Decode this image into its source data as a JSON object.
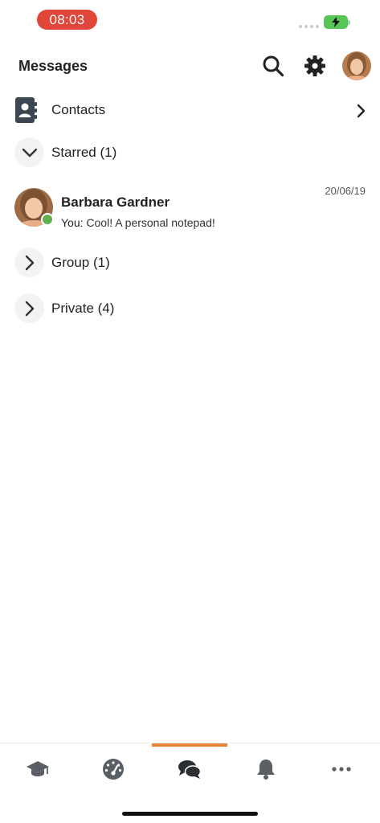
{
  "status_bar": {
    "time": "08:03",
    "time_pill_color": "#e0463a",
    "battery_color": "#58c558",
    "icons": [
      "signal-dots-icon",
      "battery-charging-icon"
    ]
  },
  "header": {
    "title": "Messages",
    "icons": [
      "search-icon",
      "gear-icon",
      "user-avatar"
    ]
  },
  "contacts": {
    "label": "Contacts",
    "icons": [
      "address-book-icon",
      "chevron-right-icon"
    ]
  },
  "sections": {
    "starred": {
      "label": "Starred (1)",
      "expanded": true,
      "icon": "chevron-down-icon"
    },
    "group": {
      "label": "Group (1)",
      "expanded": false,
      "icon": "chevron-right-icon"
    },
    "private": {
      "label": "Private (4)",
      "expanded": false,
      "icon": "chevron-right-icon"
    }
  },
  "conversations": [
    {
      "name": "Barbara Gardner",
      "date": "20/06/19",
      "preview_prefix": "You:",
      "preview": "Cool! A personal notepad!",
      "online": true,
      "online_color": "#5fb04e"
    }
  ],
  "bottom_nav": {
    "active_index": 2,
    "accent_color": "#e8833a",
    "items": [
      {
        "icon": "graduation-cap-icon"
      },
      {
        "icon": "dashboard-gauge-icon"
      },
      {
        "icon": "chat-bubbles-icon"
      },
      {
        "icon": "bell-icon"
      },
      {
        "icon": "more-dots-icon"
      }
    ]
  }
}
